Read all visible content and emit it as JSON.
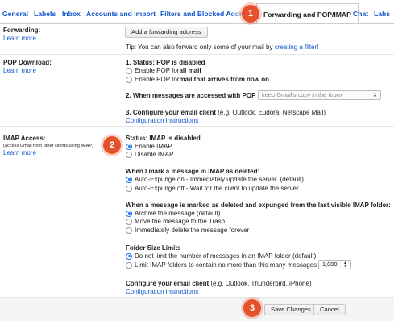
{
  "tabs": [
    "General",
    "Labels",
    "Inbox",
    "Accounts and Import",
    "Filters and Blocked Addre",
    "Forwarding and POP/IMAP",
    "Chat",
    "Labs"
  ],
  "callouts": [
    "1",
    "2",
    "3"
  ],
  "forwarding": {
    "label": "Forwarding:",
    "learn_more": "Learn more",
    "add_button": "Add a forwarding address",
    "tip_prefix": "Tip: You can also forward only some of your mail by ",
    "tip_link": "creating a filter!"
  },
  "pop": {
    "label": "POP Download:",
    "learn_more": "Learn more",
    "status_heading": "1. Status: POP is disabled",
    "opt_all_prefix": "Enable POP for ",
    "opt_all_bold": "all mail",
    "opt_now_prefix": "Enable POP for ",
    "opt_now_bold": "mail that arrives from now on",
    "access_heading": "2. When messages are accessed with POP",
    "access_select": "keep Gmail's copy in the Inbox",
    "configure_heading": "3. Configure your email client",
    "configure_note": " (e.g. Outlook, Eudora, Netscape Mail)",
    "configure_link": "Configuration instructions"
  },
  "imap": {
    "label": "IMAP Access:",
    "note": "(access Gmail from other clients using IMAP)",
    "learn_more": "Learn more",
    "status_heading": "Status: IMAP is disabled",
    "enable": "Enable IMAP",
    "disable": "Disable IMAP",
    "deleted_heading": "When I mark a message in IMAP as deleted:",
    "expunge_on": "Auto-Expunge on - Immediately update the server. (default)",
    "expunge_off": "Auto-Expunge off - Wait for the client to update the server.",
    "expunged_heading": "When a message is marked as deleted and expunged from the last visible IMAP folder:",
    "archive": "Archive the message (default)",
    "trash": "Move the message to the Trash",
    "delete_forever": "Immediately delete the message forever",
    "folder_heading": "Folder Size Limits",
    "no_limit": "Do not limit the number of messages in an IMAP folder (default)",
    "limit": "Limit IMAP folders to contain no more than this many messages",
    "limit_select": "1,000",
    "configure_heading": "Configure your email client",
    "configure_note": " (e.g. Outlook, Thunderbird, iPhone)",
    "configure_link": "Configuration instructions"
  },
  "footer": {
    "save": "Save Changes",
    "cancel": "Cancel"
  }
}
